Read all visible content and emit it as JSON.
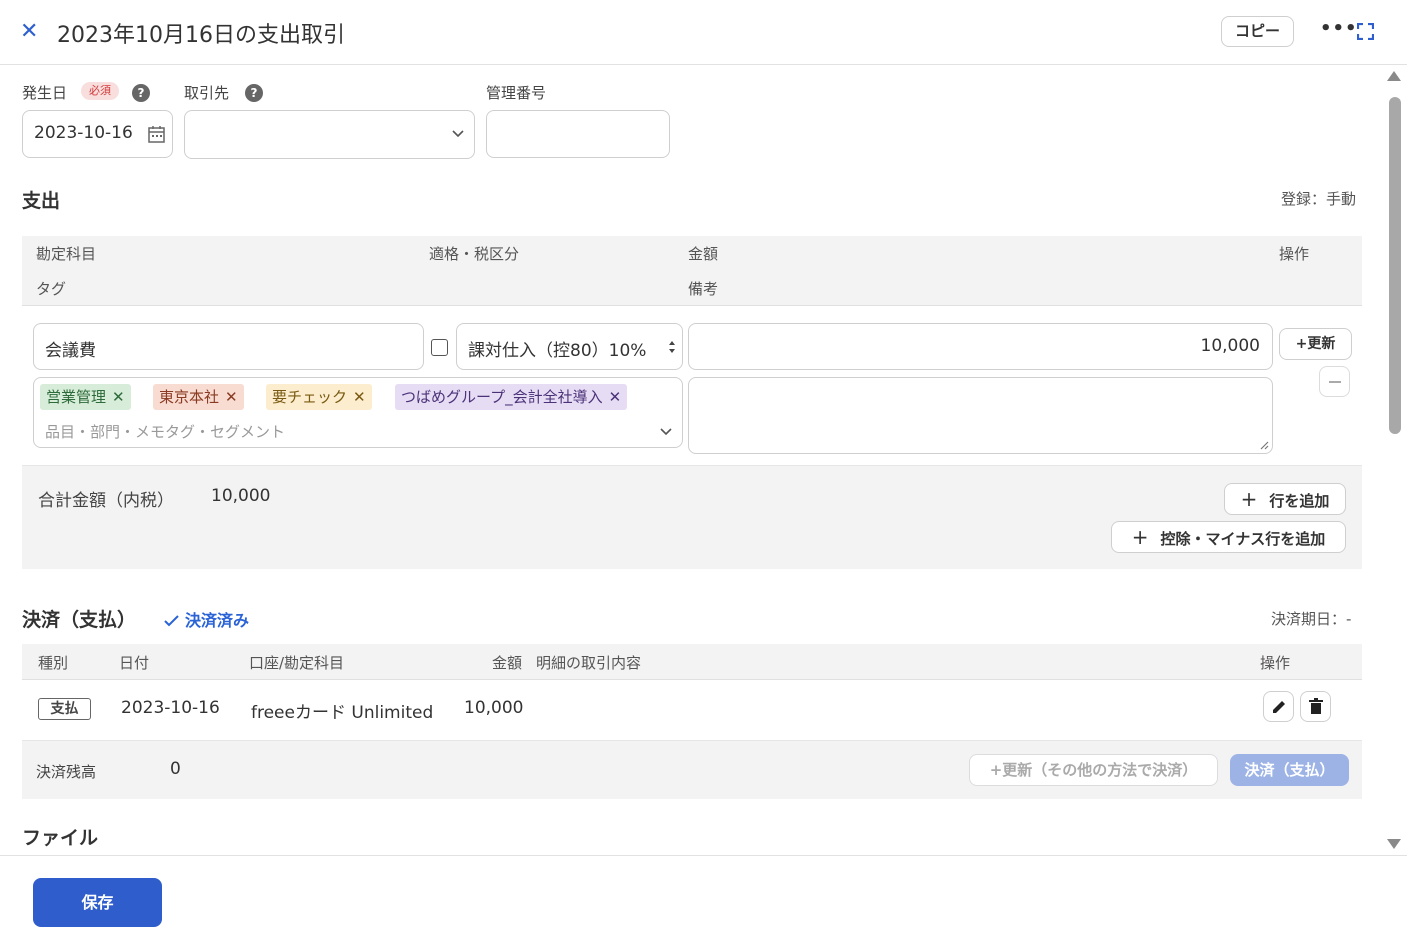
{
  "header": {
    "title": "2023年10月16日の支出取引",
    "copy_label": "コピー",
    "more_label": "•••"
  },
  "form": {
    "date_label": "発生日",
    "required_badge": "必須",
    "date_value": "2023-10-16",
    "partner_label": "取引先",
    "partner_value": "",
    "control_number_label": "管理番号",
    "control_number_value": ""
  },
  "expense": {
    "heading": "支出",
    "registration": "登録：手動",
    "columns": {
      "account": "勘定科目",
      "tax": "適格・税区分",
      "amount": "金額",
      "action": "操作",
      "tag": "タグ",
      "memo": "備考"
    },
    "row": {
      "account": "会議費",
      "tax_category": "課対仕入（控80）10%",
      "amount": "10,000",
      "update_label": "+更新",
      "tags": [
        {
          "label": "営業管理",
          "bg": "#d7ecd9",
          "fg": "#2e6b3a"
        },
        {
          "label": "東京本社",
          "bg": "#f8dcd2",
          "fg": "#8a3a22"
        },
        {
          "label": "要チェック",
          "bg": "#fbedcd",
          "fg": "#7a5a12"
        },
        {
          "label": "つばめグループ_会計全社導入",
          "bg": "#e6dcf4",
          "fg": "#4b3278"
        }
      ],
      "tag_placeholder": "品目・部門・メモタグ・セグメント",
      "memo_value": ""
    },
    "total_label": "合計金額（内税）",
    "total_value": "10,000",
    "add_row_label": "行を追加",
    "add_deduction_label": "控除・マイナス行を追加"
  },
  "settlement": {
    "heading": "決済（支払）",
    "status": "決済済み",
    "due_date": "決済期日：-",
    "columns": {
      "type": "種別",
      "date": "日付",
      "account": "口座/勘定科目",
      "amount": "金額",
      "detail": "明細の取引内容",
      "action": "操作"
    },
    "row": {
      "type": "支払",
      "date": "2023-10-16",
      "account": "freeeカード Unlimited",
      "amount": "10,000"
    },
    "balance_label": "決済残高",
    "balance_value": "0",
    "other_method_label": "+更新（その他の方法で決済）",
    "pay_label": "決済（支払）"
  },
  "files": {
    "heading": "ファイル"
  },
  "footer": {
    "save_label": "保存"
  },
  "colors": {
    "accent": "#2f5dcb",
    "link": "#2a63d6",
    "pay_disabled": "#9db3e6"
  }
}
